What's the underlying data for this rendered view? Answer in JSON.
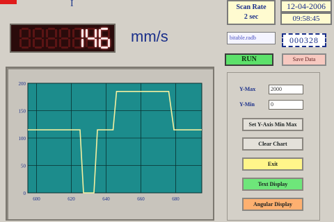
{
  "header": {
    "pipe_marker": "I"
  },
  "display": {
    "speed_value": "146",
    "unit": "mm/s"
  },
  "scan": {
    "label": "Scan Rate",
    "value": "2 sec"
  },
  "clock": {
    "date": "12-04-2006",
    "time": "09:58:45"
  },
  "file": {
    "name": "bitable.radb"
  },
  "counter": {
    "value": "000328"
  },
  "actions": {
    "run_label": "RUN",
    "save_label": "Save Data"
  },
  "controls": {
    "ymax_label": "Y-Max",
    "ymax_value": "2000",
    "ymin_label": "Y-Min",
    "ymin_value": "0",
    "set_axis_label": "Set Y-Axis Min Max",
    "clear_label": "Clear Chart",
    "exit_label": "Exit",
    "text_display_label": "Text Display",
    "angular_display_label": "Angular Display"
  },
  "colors": {
    "plot_bg": "#1c8c8c",
    "line": "#f4f0a0",
    "grid": "#0a3030",
    "led_on": "#ffe6e6"
  },
  "chart_data": {
    "type": "line",
    "title": "",
    "xlabel": "",
    "ylabel": "",
    "xlim": [
      595,
      695
    ],
    "ylim": [
      0,
      2000
    ],
    "x_ticks": [
      "600",
      "620",
      "640",
      "660",
      "680"
    ],
    "y_ticks": [
      "0",
      "50",
      "100",
      "150",
      "200"
    ],
    "grid": true,
    "series": [
      {
        "x": [
          595,
          625,
          627,
          633,
          635,
          644,
          646,
          653,
          656,
          676,
          679,
          695
        ],
        "y": [
          1150,
          1150,
          0,
          0,
          1150,
          1150,
          1850,
          1850,
          1850,
          1850,
          1150,
          1150
        ]
      }
    ]
  }
}
